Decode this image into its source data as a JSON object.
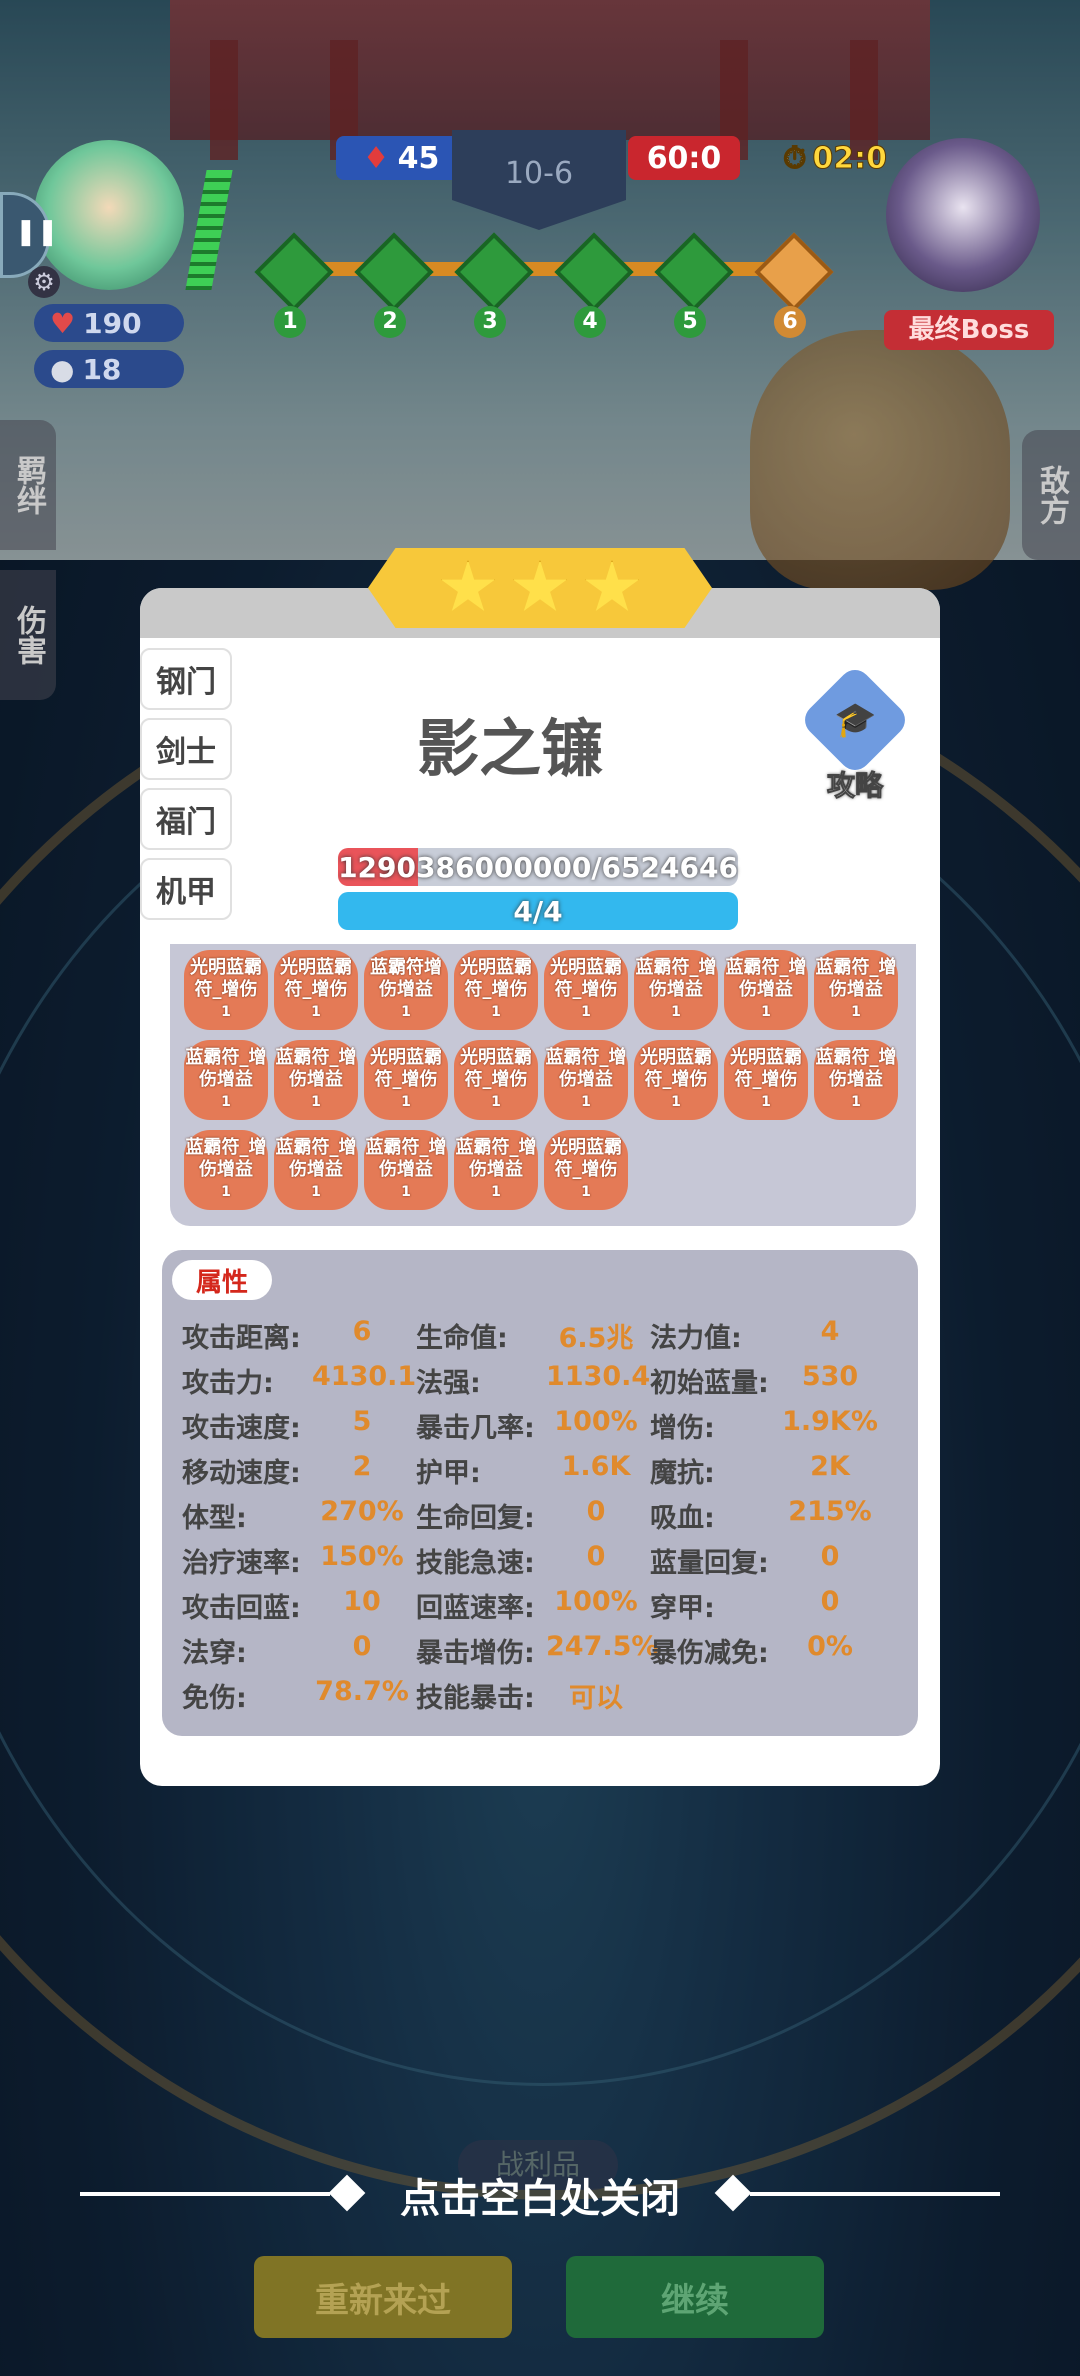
{
  "hud": {
    "player_hp": "190",
    "player_coins": "18",
    "blood_count": "45",
    "stage": "10-6",
    "score": "60:0",
    "timer": "02:0",
    "boss_label": "最终Boss",
    "path_nodes": [
      "1",
      "2",
      "3",
      "4",
      "5",
      "6"
    ]
  },
  "side_tabs": {
    "left_top": "羁绊",
    "left_bottom": "伤害",
    "right": "敌方"
  },
  "modal": {
    "hero_name": "影之镰",
    "guide_label": "攻略",
    "hp_bar": "1290386000000/6524646",
    "mana_bar": "4/4",
    "tabs": [
      "钢门",
      "剑士",
      "福门",
      "机甲"
    ],
    "buffs": [
      [
        "光明蓝霸符_增伤",
        "光明蓝霸符_增伤",
        "蓝霸符增伤增益",
        "光明蓝霸符_增伤",
        "光明蓝霸符_增伤",
        "蓝霸符_增伤增益",
        "蓝霸符_增伤增益",
        "蓝霸符_增伤增益"
      ],
      [
        "蓝霸符_增伤增益",
        "蓝霸符_增伤增益",
        "光明蓝霸符_增伤",
        "光明蓝霸符_增伤",
        "蓝霸符_增伤增益",
        "光明蓝霸符_增伤",
        "光明蓝霸符_增伤",
        "蓝霸符_增伤增益"
      ],
      [
        "蓝霸符_增伤增益",
        "蓝霸符_增伤增益",
        "蓝霸符_增伤增益",
        "蓝霸符_增伤增益",
        "光明蓝霸符_增伤"
      ]
    ],
    "buff_count": "1",
    "attr_title": "属性",
    "attributes": [
      [
        [
          "攻击距离:",
          "6"
        ],
        [
          "生命值:",
          "6.5兆"
        ],
        [
          "法力值:",
          "4"
        ]
      ],
      [
        [
          "攻击力:",
          "4130.1"
        ],
        [
          "法强:",
          "1130.4"
        ],
        [
          "初始蓝量:",
          "530"
        ]
      ],
      [
        [
          "攻击速度:",
          "5"
        ],
        [
          "暴击几率:",
          "100%"
        ],
        [
          "增伤:",
          "1.9K%"
        ]
      ],
      [
        [
          "移动速度:",
          "2"
        ],
        [
          "护甲:",
          "1.6K"
        ],
        [
          "魔抗:",
          "2K"
        ]
      ],
      [
        [
          "体型:",
          "270%"
        ],
        [
          "生命回复:",
          "0"
        ],
        [
          "吸血:",
          "215%"
        ]
      ],
      [
        [
          "治疗速率:",
          "150%"
        ],
        [
          "技能急速:",
          "0"
        ],
        [
          "蓝量回复:",
          "0"
        ]
      ],
      [
        [
          "攻击回蓝:",
          "10"
        ],
        [
          "回蓝速率:",
          "100%"
        ],
        [
          "穿甲:",
          "0"
        ]
      ],
      [
        [
          "法穿:",
          "0"
        ],
        [
          "暴击增伤:",
          "247.5%"
        ],
        [
          "暴伤减免:",
          "0%"
        ]
      ],
      [
        [
          "免伤:",
          "78.7%"
        ],
        [
          "技能暴击:",
          "可以"
        ],
        [
          "",
          ""
        ]
      ]
    ]
  },
  "bottom": {
    "close_hint": "点击空白处关闭",
    "loot_label": "战利品",
    "retry_label": "重新来过",
    "continue_label": "继续"
  }
}
